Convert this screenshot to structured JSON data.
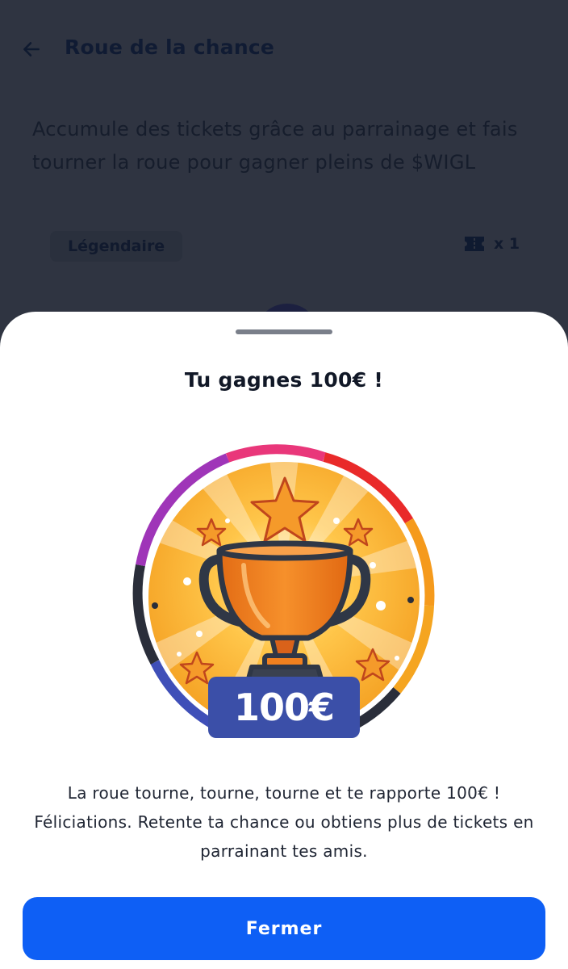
{
  "header": {
    "title": "Roue de la chance",
    "back_icon": "arrow-left-icon"
  },
  "intro": {
    "text": "Accumule des tickets grâce au parrainage et fais tourner la roue pour gagner pleins de $WIGL"
  },
  "wheel_info": {
    "rarity": "Légendaire",
    "ticket_icon": "ticket-icon",
    "ticket_count": "x 1"
  },
  "modal": {
    "title": "Tu gagnes 100€ !",
    "badge": {
      "icon": "trophy-icon",
      "amount_label": "100€"
    },
    "message": "La roue tourne, tourne, tourne et te rapporte 100€ ! Féliciations. Retente ta chance ou obtiens plus de tickets en parrainant tes amis.",
    "close_label": "Fermer"
  },
  "colors": {
    "overlay_background": "#2f3441",
    "sheet_background": "#ffffff",
    "primary_button": "#0e5ff5",
    "badge_label": "#3b4fa8",
    "trophy_orange": "#f0801f"
  }
}
